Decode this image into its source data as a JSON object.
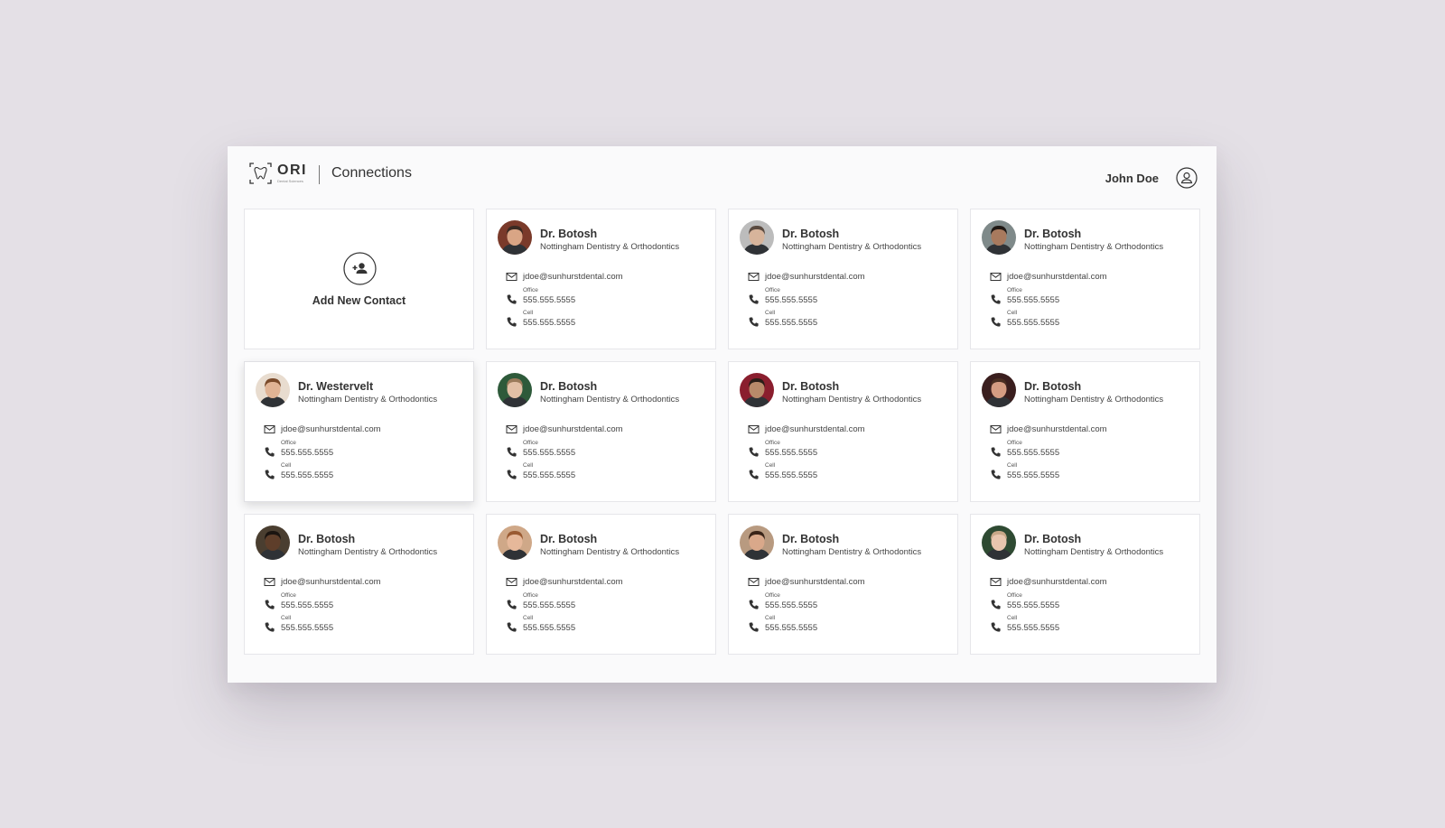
{
  "header": {
    "brand": "ORI",
    "brand_sub": "Dental Sciences",
    "title": "Connections",
    "user_name": "John Doe"
  },
  "add_card": {
    "label": "Add New Contact"
  },
  "contacts": [
    {
      "name": "Dr. Botosh",
      "org": "Nottingham Dentistry & Orthodontics",
      "email": "jdoe@sunhurstdental.com",
      "office_label": "Office",
      "office": "555.555.5555",
      "cell_label": "Cell",
      "cell": "555.555.5555",
      "avatar": {
        "bg": "#7a3a2a",
        "skin": "#d9a585",
        "hair": "#3a2a22"
      }
    },
    {
      "name": "Dr. Botosh",
      "org": "Nottingham Dentistry & Orthodontics",
      "email": "jdoe@sunhurstdental.com",
      "office_label": "Office",
      "office": "555.555.5555",
      "cell_label": "Cell",
      "cell": "555.555.5555",
      "avatar": {
        "bg": "#bcbcbc",
        "skin": "#d7b49b",
        "hair": "#5a4a40"
      }
    },
    {
      "name": "Dr. Botosh",
      "org": "Nottingham Dentistry & Orthodontics",
      "email": "jdoe@sunhurstdental.com",
      "office_label": "Office",
      "office": "555.555.5555",
      "cell_label": "Cell",
      "cell": "555.555.5555",
      "avatar": {
        "bg": "#7f8a8a",
        "skin": "#a87a5e",
        "hair": "#1f1814"
      }
    },
    {
      "name": "Dr. Westervelt",
      "org": "Nottingham Dentistry & Orthodontics",
      "email": "jdoe@sunhurstdental.com",
      "office_label": "Office",
      "office": "555.555.5555",
      "cell_label": "Cell",
      "cell": "555.555.5555",
      "avatar": {
        "bg": "#e8dccf",
        "skin": "#e0b394",
        "hair": "#7a4a2a"
      }
    },
    {
      "name": "Dr. Botosh",
      "org": "Nottingham Dentistry & Orthodontics",
      "email": "jdoe@sunhurstdental.com",
      "office_label": "Office",
      "office": "555.555.5555",
      "cell_label": "Cell",
      "cell": "555.555.5555",
      "avatar": {
        "bg": "#2e5a3a",
        "skin": "#e2bfa5",
        "hair": "#9a7a5a"
      }
    },
    {
      "name": "Dr. Botosh",
      "org": "Nottingham Dentistry & Orthodontics",
      "email": "jdoe@sunhurstdental.com",
      "office_label": "Office",
      "office": "555.555.5555",
      "cell_label": "Cell",
      "cell": "555.555.5555",
      "avatar": {
        "bg": "#8a1e2e",
        "skin": "#b88a6a",
        "hair": "#2a1e18"
      }
    },
    {
      "name": "Dr. Botosh",
      "org": "Nottingham Dentistry & Orthodontics",
      "email": "jdoe@sunhurstdental.com",
      "office_label": "Office",
      "office": "555.555.5555",
      "cell_label": "Cell",
      "cell": "555.555.5555",
      "avatar": {
        "bg": "#3a1e1e",
        "skin": "#d59c82",
        "hair": "#4a2e22"
      }
    },
    {
      "name": "Dr. Botosh",
      "org": "Nottingham Dentistry & Orthodontics",
      "email": "jdoe@sunhurstdental.com",
      "office_label": "Office",
      "office": "555.555.5555",
      "cell_label": "Cell",
      "cell": "555.555.5555",
      "avatar": {
        "bg": "#4a3e30",
        "skin": "#5e3e2a",
        "hair": "#1a1410"
      }
    },
    {
      "name": "Dr. Botosh",
      "org": "Nottingham Dentistry & Orthodontics",
      "email": "jdoe@sunhurstdental.com",
      "office_label": "Office",
      "office": "555.555.5555",
      "cell_label": "Cell",
      "cell": "555.555.5555",
      "avatar": {
        "bg": "#cfa888",
        "skin": "#e6b89a",
        "hair": "#9a5a32"
      }
    },
    {
      "name": "Dr. Botosh",
      "org": "Nottingham Dentistry & Orthodontics",
      "email": "jdoe@sunhurstdental.com",
      "office_label": "Office",
      "office": "555.555.5555",
      "cell_label": "Cell",
      "cell": "555.555.5555",
      "avatar": {
        "bg": "#b89a80",
        "skin": "#d9a88a",
        "hair": "#3a2418"
      }
    },
    {
      "name": "Dr. Botosh",
      "org": "Nottingham Dentistry & Orthodontics",
      "email": "jdoe@sunhurstdental.com",
      "office_label": "Office",
      "office": "555.555.5555",
      "cell_label": "Cell",
      "cell": "555.555.5555",
      "avatar": {
        "bg": "#2e4a32",
        "skin": "#e8c6ae",
        "hair": "#c8a888"
      }
    }
  ],
  "active_card": 3
}
